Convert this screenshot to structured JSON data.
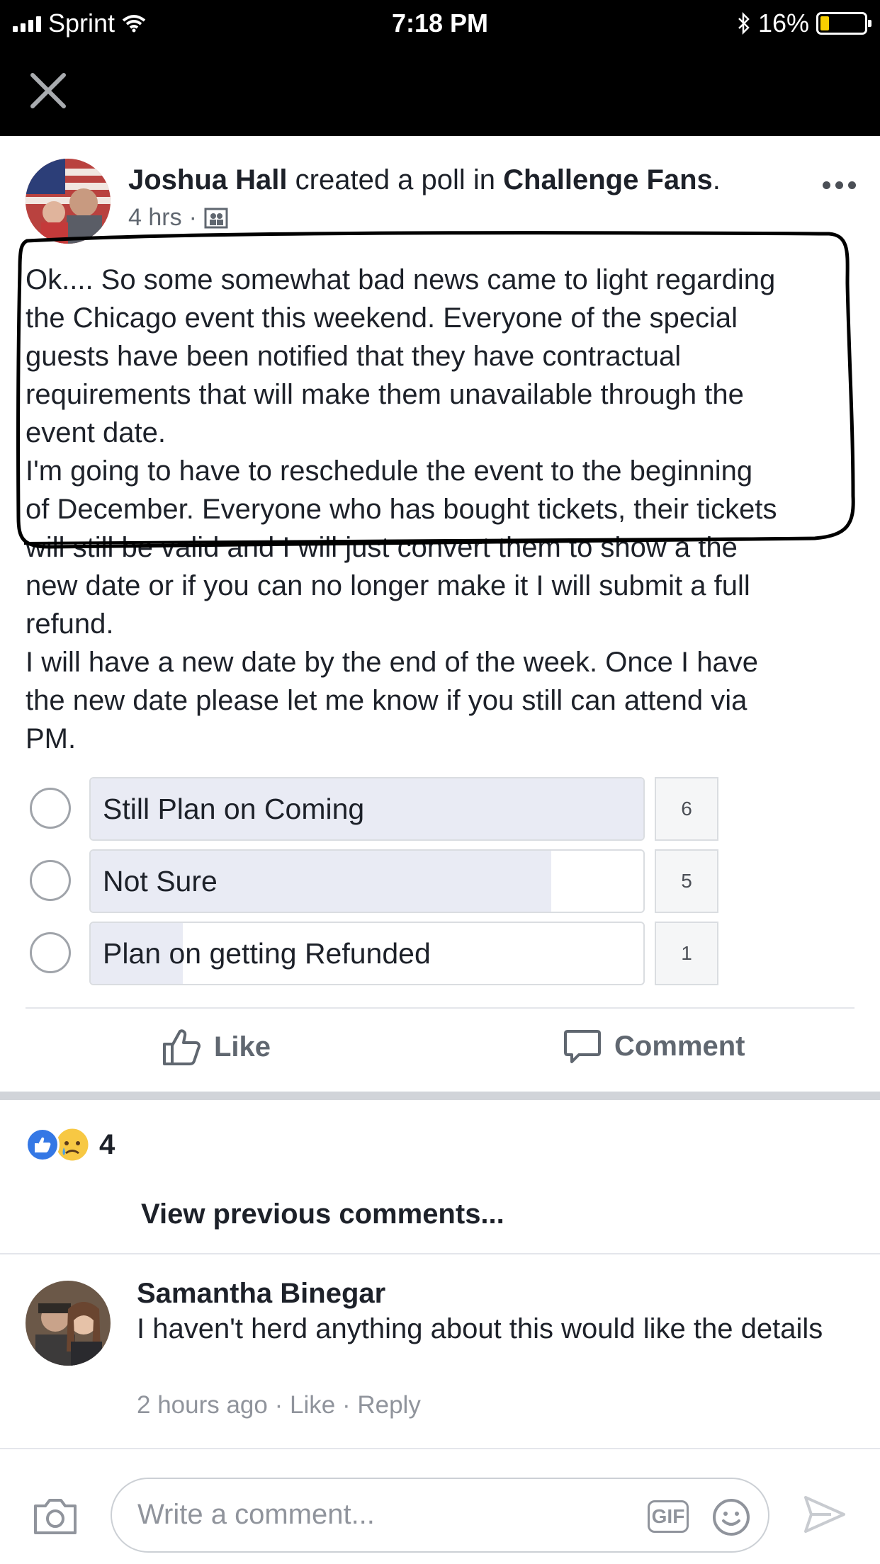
{
  "status_bar": {
    "carrier": "Sprint",
    "time": "7:18 PM",
    "battery": "16%"
  },
  "post": {
    "author": "Joshua Hall",
    "action": "created a poll in",
    "group": "Challenge Fans",
    "timestamp": "4 hrs",
    "dot": "·",
    "body": "Ok.... So some somewhat bad news came to light regarding\nthe Chicago event this weekend. Everyone of the special\nguests have been notified that they have contractual\nrequirements that will make them unavailable through the\nevent date.\nI'm going to have to reschedule the event to the beginning\nof December. Everyone who has bought tickets, their tickets\nwill still be valid and I will just convert them to show a the\nnew date or if you can no longer make it I will submit a full\nrefund.\nI will have a new date by the end of the week. Once I have\nthe new date please let me know if you still can attend via\nPM."
  },
  "poll": {
    "options": [
      {
        "label": "Still Plan on Coming",
        "votes": "6",
        "fraction": 1.0
      },
      {
        "label": "Not Sure",
        "votes": "5",
        "fraction": 0.833
      },
      {
        "label": "Plan on getting Refunded",
        "votes": "1",
        "fraction": 0.167
      }
    ]
  },
  "actions": {
    "like": "Like",
    "comment": "Comment"
  },
  "reactions": {
    "count": "4"
  },
  "comments": {
    "view_previous": "View previous comments...",
    "items": [
      {
        "author": "Samantha Binegar",
        "text": "I haven't herd anything about this would like the details",
        "time": "2 hours ago",
        "like": "Like",
        "reply": "Reply"
      }
    ]
  },
  "composer": {
    "placeholder": "Write a comment...",
    "gif": "GIF"
  },
  "colors": {
    "header_bg": "#000000",
    "poll_fill": "#e9ebf4",
    "like_blue": "#3578e5",
    "text_primary": "#1d2129",
    "text_secondary": "#606770"
  }
}
